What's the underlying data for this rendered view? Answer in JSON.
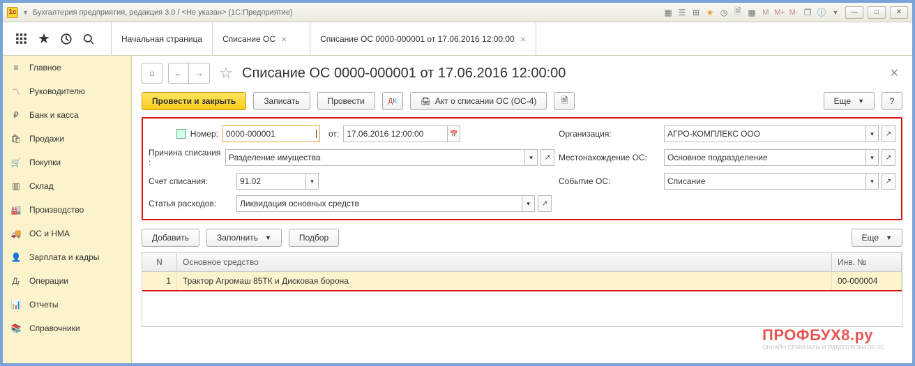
{
  "window": {
    "title": "Бухгалтерия предприятия, редакция 3.0 / <Не указан>   (1С:Предприятие)"
  },
  "tabs": [
    {
      "label": "Начальная страница",
      "closable": false
    },
    {
      "label": "Списание ОС",
      "closable": true
    },
    {
      "label": "Списание ОС 0000-000001 от 17.06.2016 12:00:00",
      "closable": true,
      "active": true
    }
  ],
  "sidebar": {
    "items": [
      {
        "icon": "menu",
        "label": "Главное"
      },
      {
        "icon": "trend",
        "label": "Руководителю"
      },
      {
        "icon": "ruble",
        "label": "Банк и касса"
      },
      {
        "icon": "bag",
        "label": "Продажи"
      },
      {
        "icon": "cart",
        "label": "Покупки"
      },
      {
        "icon": "warehouse",
        "label": "Склад"
      },
      {
        "icon": "factory",
        "label": "Производство"
      },
      {
        "icon": "truck",
        "label": "ОС и НМА"
      },
      {
        "icon": "person",
        "label": "Зарплата и кадры"
      },
      {
        "icon": "ops",
        "label": "Операции"
      },
      {
        "icon": "reports",
        "label": "Отчеты"
      },
      {
        "icon": "books",
        "label": "Справочники"
      }
    ]
  },
  "page": {
    "title": "Списание ОС 0000-000001 от 17.06.2016 12:00:00"
  },
  "actions": {
    "post_close": "Провести и закрыть",
    "save": "Записать",
    "post": "Провести",
    "act": "Акт о списании ОС (ОС-4)",
    "more": "Еще"
  },
  "form": {
    "number_label": "Номер:",
    "number_value": "0000-000001",
    "date_label": "от:",
    "date_value": "17.06.2016 12:00:00",
    "org_label": "Организация:",
    "org_value": "АГРО-КОМПЛЕКС ООО",
    "reason_label": "Причина списания :",
    "reason_value": "Разделение имущества",
    "location_label": "Местонахождение ОС:",
    "location_value": "Основное подразделение",
    "account_label": "Счет списания:",
    "account_value": "91.02",
    "event_label": "Событие ОС:",
    "event_value": "Списание",
    "expense_label": "Статья расходов:",
    "expense_value": "Ликвидация основных средств"
  },
  "table_actions": {
    "add": "Добавить",
    "fill": "Заполнить",
    "pick": "Подбор",
    "more": "Еще"
  },
  "table": {
    "headers": {
      "n": "N",
      "name": "Основное средство",
      "inv": "Инв. №"
    },
    "rows": [
      {
        "n": "1",
        "name": "Трактор Агромаш 85ТК и Дисковая борона",
        "inv": "00-000004"
      }
    ]
  },
  "watermark": {
    "main": "ПРОФБУХ8.ру",
    "sub": "ОНЛАЙН СЕМИНАРЫ И ВИДЕОУРОКИ ПО 1С"
  }
}
